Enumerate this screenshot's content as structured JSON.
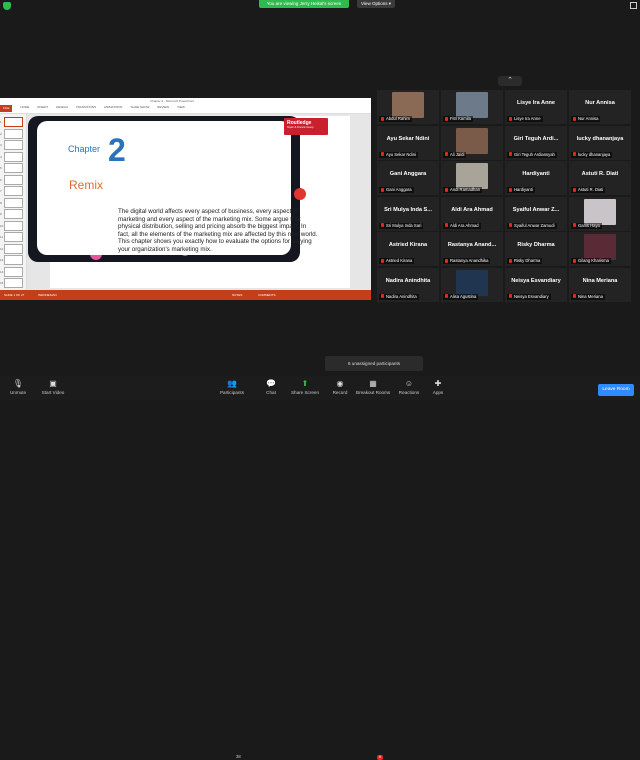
{
  "top": {
    "viewing_banner": "You are viewing Jerry Heikal's screen",
    "view_options": "View Options ▾"
  },
  "presentation": {
    "window_title": "Chapter 2 - Microsoft PowerPoint",
    "ribbon_tabs": [
      "FILE",
      "HOME",
      "INSERT",
      "DESIGN",
      "TRANSITIONS",
      "ANIMATIONS",
      "SLIDE SHOW",
      "REVIEW",
      "VIEW"
    ],
    "thumb_numbers": [
      "1",
      "2",
      "3",
      "4",
      "5",
      "6",
      "7",
      "8",
      "9",
      "10",
      "11",
      "12",
      "13",
      "14",
      "15"
    ],
    "chapter_label": "Chapter",
    "chapter_number": "2",
    "slide_title": "Remix",
    "body_text": "The digital world affects every aspect of business, every aspect of marketing and every aspect of the marketing mix. Some argue that physical distribution, selling and pricing absorb the biggest impact. In fact, all the elements of the marketing mix are affected by this new world. This chapter shows you exactly how to evaluate the options for varying your organization's marketing mix.",
    "publisher": "Routledge",
    "publisher_sub": "Taylor & Francis Group",
    "status_slide": "SLIDE 1 OF 27",
    "status_lang": "INDONESIAN",
    "status_notes": "NOTES",
    "status_comments": "COMMENTS"
  },
  "participants": [
    {
      "big": "",
      "label": "Abdul Rahim",
      "video": true,
      "color": "#8a6a55"
    },
    {
      "big": "",
      "label": "Fitri Kamila",
      "video": true,
      "color": "#6d7a8a"
    },
    {
      "big": "Lisye Ira Anne",
      "label": "Lisye Ira Anne",
      "video": false
    },
    {
      "big": "Nur Annisa",
      "label": "Nur Annisa",
      "video": false
    },
    {
      "big": "Ayu Sekar Ndini",
      "label": "Ayu Sekar Ndini",
      "video": false
    },
    {
      "big": "",
      "label": "Ali Jaidi",
      "video": true,
      "color": "#7a5a48"
    },
    {
      "big": "Giri Teguh Ardi...",
      "label": "Giri Teguh Ardiansyah",
      "video": false
    },
    {
      "big": "lucky dhananjaya",
      "label": "lucky dhananjaya",
      "video": false
    },
    {
      "big": "Gani Anggara",
      "label": "Gani Anggara",
      "video": false
    },
    {
      "big": "",
      "label": "Andi Ramadhan",
      "video": true,
      "color": "#a9a49a"
    },
    {
      "big": "Hardiyanti",
      "label": "Hardiyanti",
      "video": false
    },
    {
      "big": "Astuti R. Diati",
      "label": "Astuti R. Diati",
      "video": false
    },
    {
      "big": "Sri Mulya Inda S...",
      "label": "Sri Mulya Inda Sari",
      "video": false
    },
    {
      "big": "Aldi Ara Ahmad",
      "label": "Aldi Ara Ahmad",
      "video": false
    },
    {
      "big": "Syaiful Anwar Z...",
      "label": "Syaiful Anwar Zamudi",
      "video": false
    },
    {
      "big": "",
      "label": "Ganis Haya",
      "video": true,
      "color": "#c9c4c8"
    },
    {
      "big": "Astried Kirana",
      "label": "Astried Kirana",
      "video": false
    },
    {
      "big": "Rastanya Anand...",
      "label": "Rastanya Anandhika",
      "video": false
    },
    {
      "big": "Risky Dharma",
      "label": "Risky Dharma",
      "video": false
    },
    {
      "big": "",
      "label": "Gilang Kharisma",
      "video": true,
      "color": "#5a2a36"
    },
    {
      "big": "Nadira Anindhita",
      "label": "Nadira Anindhita",
      "video": false
    },
    {
      "big": "",
      "label": "Alisa Agustina",
      "video": true,
      "color": "#1f3550"
    },
    {
      "big": "Neisya Esvandiary",
      "label": "Neisya Esvandiary",
      "video": false
    },
    {
      "big": "Nina Meriana",
      "label": "Nina Meriana",
      "video": false
    }
  ],
  "unassigned": "6 unassigned participants",
  "toolbar": {
    "unmute": "Unmute",
    "start_video": "Start Video",
    "participants": "Participants",
    "participants_count": "38",
    "chat": "Chat",
    "share_screen": "Share Screen",
    "record": "Record",
    "breakout_rooms": "Breakout Rooms",
    "breakout_badge": "6",
    "reactions": "Reactions",
    "apps": "Apps",
    "leave": "Leave Room"
  }
}
